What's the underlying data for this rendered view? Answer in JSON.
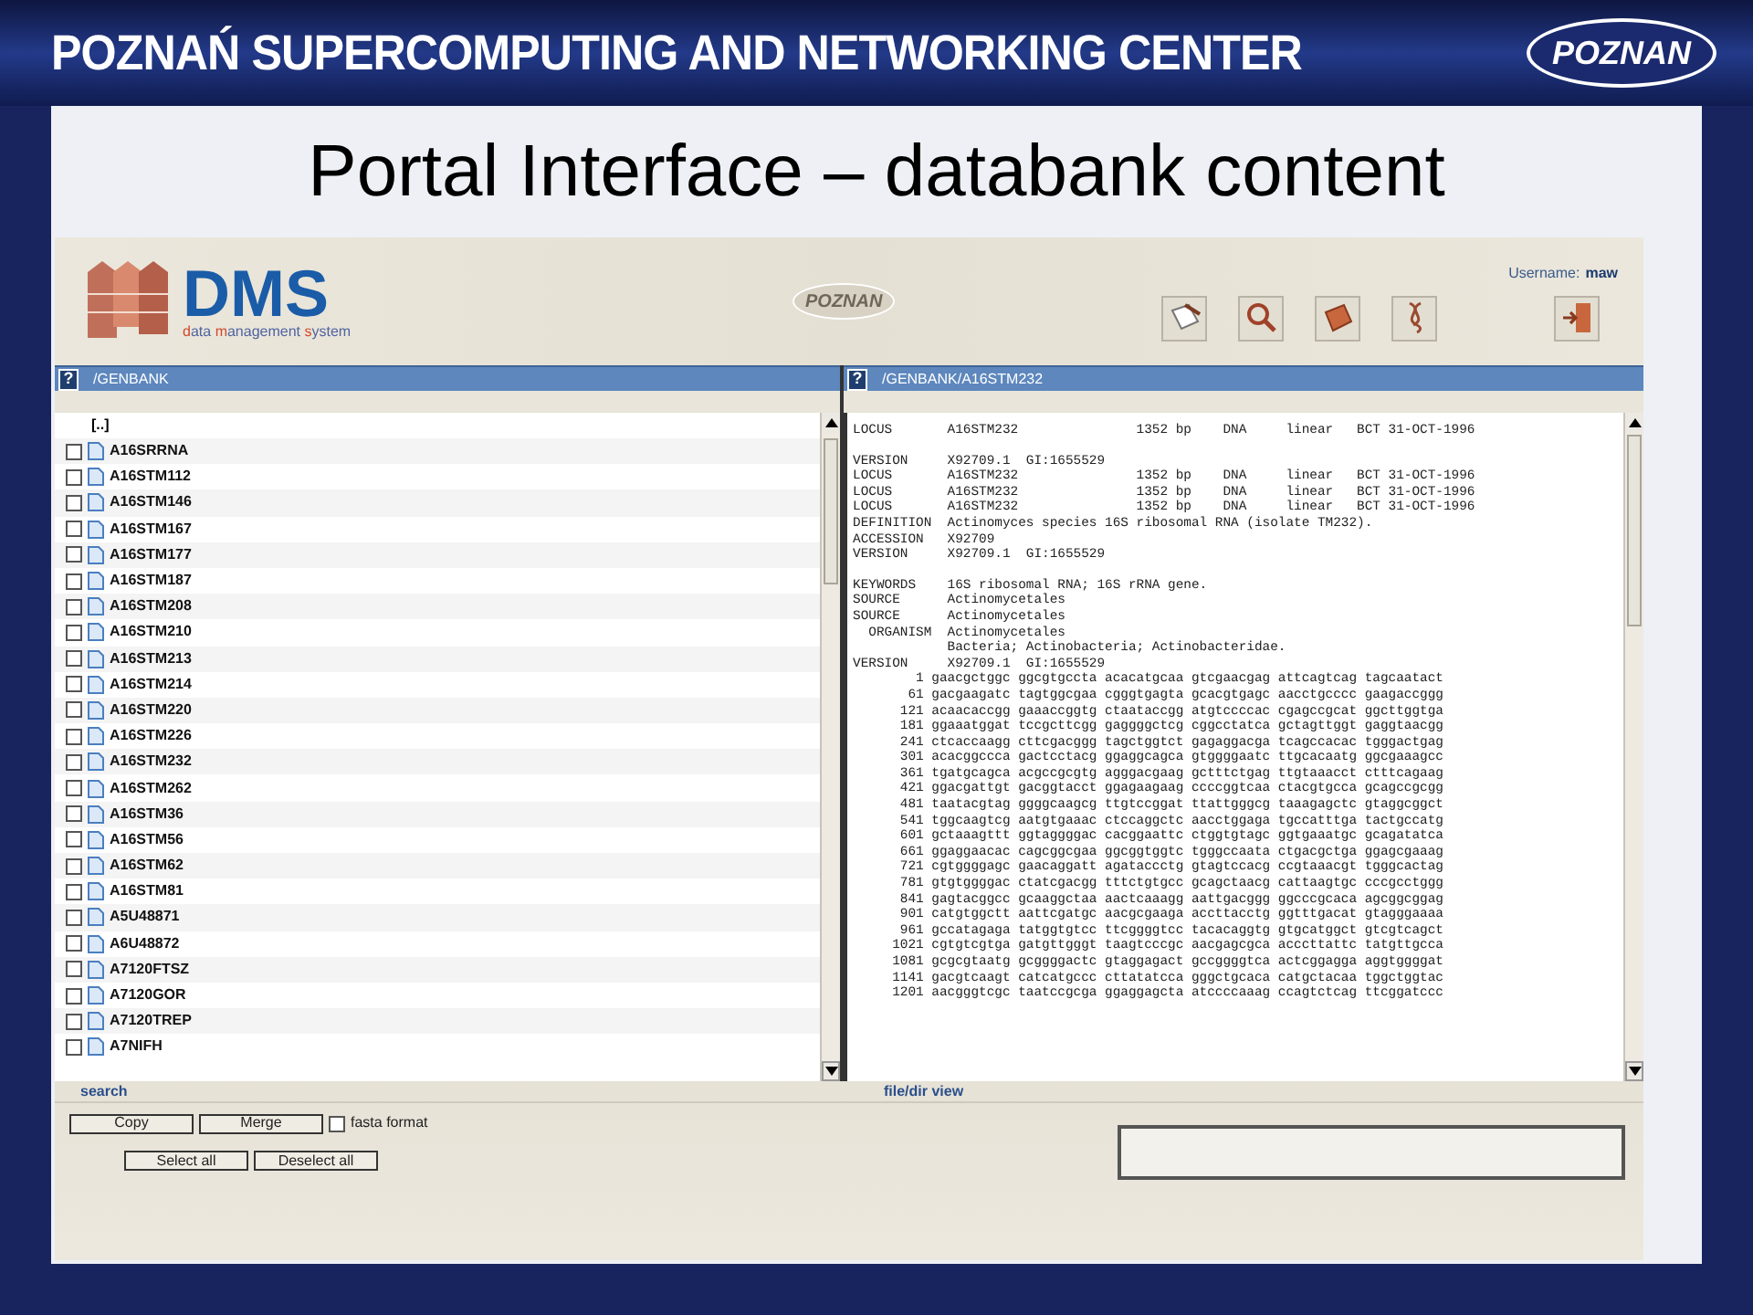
{
  "banner": {
    "title": "POZNAŃ SUPERCOMPUTING AND NETWORKING CENTER",
    "logo_text": "POZNAN"
  },
  "slide_title": "Portal Interface – databank content",
  "app": {
    "logo": {
      "name": "DMS",
      "subtitle": "data management system"
    },
    "center_logo_text": "POZNAN",
    "username_label": "Username:",
    "username": "maw",
    "left_pane": {
      "help": "?",
      "path": "/GENBANK",
      "parent": "[..]",
      "items": [
        {
          "name": "A16SRRNA",
          "checked": false
        },
        {
          "name": "A16STM112",
          "checked": false
        },
        {
          "name": "A16STM146",
          "checked": false
        },
        {
          "name": "A16STM167",
          "checked": false
        },
        {
          "name": "A16STM177",
          "checked": false
        },
        {
          "name": "A16STM187",
          "checked": false
        },
        {
          "name": "A16STM208",
          "checked": false
        },
        {
          "name": "A16STM210",
          "checked": false
        },
        {
          "name": "A16STM213",
          "checked": false
        },
        {
          "name": "A16STM214",
          "checked": false
        },
        {
          "name": "A16STM220",
          "checked": false
        },
        {
          "name": "A16STM226",
          "checked": false
        },
        {
          "name": "A16STM232",
          "checked": false
        },
        {
          "name": "A16STM262",
          "checked": false
        },
        {
          "name": "A16STM36",
          "checked": false
        },
        {
          "name": "A16STM56",
          "checked": false
        },
        {
          "name": "A16STM62",
          "checked": false
        },
        {
          "name": "A16STM81",
          "checked": false
        },
        {
          "name": "A5U48871",
          "checked": false
        },
        {
          "name": "A6U48872",
          "checked": false
        },
        {
          "name": "A7120FTSZ",
          "checked": false
        },
        {
          "name": "A7120GOR",
          "checked": false
        },
        {
          "name": "A7120TREP",
          "checked": false
        },
        {
          "name": "A7NIFH",
          "checked": false
        }
      ]
    },
    "right_pane": {
      "help": "?",
      "path": "/GENBANK/A16STM232",
      "blocks": [
        [
          "LOCUS       A16STM232               1352 bp    DNA     linear   BCT 31-OCT-1996"
        ],
        [
          "VERSION     X92709.1  GI:1655529",
          "LOCUS       A16STM232               1352 bp    DNA     linear   BCT 31-OCT-1996",
          "LOCUS       A16STM232               1352 bp    DNA     linear   BCT 31-OCT-1996",
          "LOCUS       A16STM232               1352 bp    DNA     linear   BCT 31-OCT-1996",
          "DEFINITION  Actinomyces species 16S ribosomal RNA (isolate TM232).",
          "ACCESSION   X92709",
          "VERSION     X92709.1  GI:1655529"
        ],
        [
          "KEYWORDS    16S ribosomal RNA; 16S rRNA gene.",
          "SOURCE      Actinomycetales",
          "SOURCE      Actinomycetales",
          "  ORGANISM  Actinomycetales",
          "            Bacteria; Actinobacteria; Actinobacteridae.",
          "VERSION     X92709.1  GI:1655529",
          "        1 gaacgctggc ggcgtgccta acacatgcaa gtcgaacgag attcagtcag tagcaatact",
          "       61 gacgaagatc tagtggcgaa cgggtgagta gcacgtgagc aacctgcccc gaagaccggg",
          "      121 acaacaccgg gaaaccggtg ctaataccgg atgtccccac cgagccgcat ggcttggtga",
          "      181 ggaaatggat tccgcttcgg gaggggctcg cggcctatca gctagttggt gaggtaacgg",
          "      241 ctcaccaagg cttcgacggg tagctggtct gagaggacga tcagccacac tgggactgag",
          "      301 acacggccca gactcctacg ggaggcagca gtggggaatc ttgcacaatg ggcgaaagcc",
          "      361 tgatgcagca acgccgcgtg agggacgaag gctttctgag ttgtaaacct ctttcagaag",
          "      421 ggacgattgt gacggtacct ggagaagaag ccccggtcaa ctacgtgcca gcagccgcgg",
          "      481 taatacgtag ggggcaagcg ttgtccggat ttattgggcg taaagagctc gtaggcggct",
          "      541 tggcaagtcg aatgtgaaac ctccaggctc aacctggaga tgccatttga tactgccatg",
          "      601 gctaaagttt ggtaggggac cacggaattc ctggtgtagc ggtgaaatgc gcagatatca",
          "      661 ggaggaacac cagcggcgaa ggcggtggtc tgggccaata ctgacgctga ggagcgaaag",
          "      721 cgtggggagc gaacaggatt agataccctg gtagtccacg ccgtaaacgt tgggcactag",
          "      781 gtgtggggac ctatcgacgg tttctgtgcc gcagctaacg cattaagtgc cccgcctggg",
          "      841 gagtacggcc gcaaggctaa aactcaaagg aattgacggg ggcccgcaca agcggcggag",
          "      901 catgtggctt aattcgatgc aacgcgaaga accttacctg ggtttgacat gtagggaaaa",
          "      961 gccatagaga tatggtgtcc ttcggggtcc tacacaggtg gtgcatggct gtcgtcagct",
          "     1021 cgtgtcgtga gatgttgggt taagtcccgc aacgagcgca acccttattc tatgttgcca",
          "     1081 gcgcgtaatg gcggggactc gtaggagact gccggggtca actcggagga aggtggggat",
          "     1141 gacgtcaagt catcatgccc cttatatcca gggctgcaca catgctacaa tggctggtac",
          "     1201 aacgggtcgc taatccgcga ggaggagcta atccccaaag ccagtctcag ttcggatccc"
        ]
      ]
    },
    "bottom": {
      "left_title": "search",
      "right_title": "file/dir view",
      "buttons_row1": [
        "Copy",
        "Merge"
      ],
      "fasta": {
        "label": "fasta format",
        "checked": false
      },
      "buttons_row2": [
        "Select all",
        "Deselect all"
      ]
    }
  }
}
